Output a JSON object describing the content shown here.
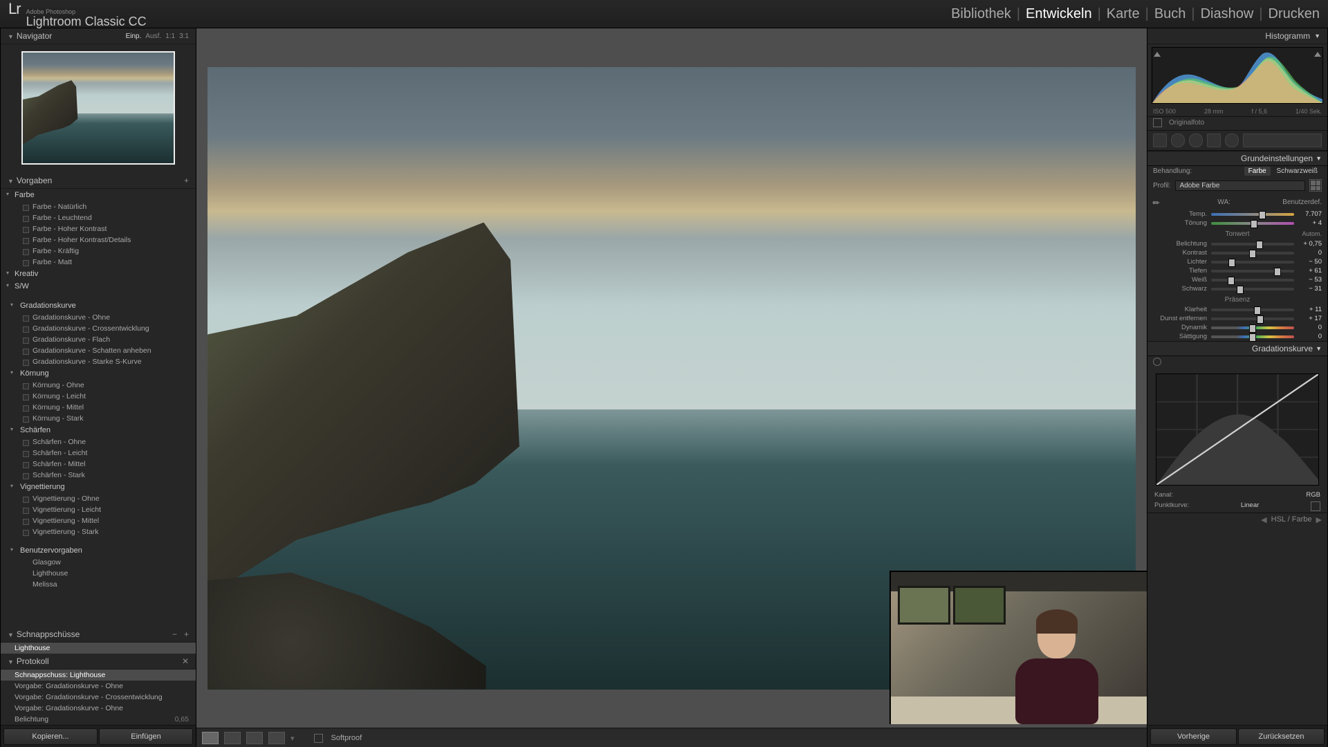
{
  "header": {
    "adobe": "Adobe Photoshop",
    "app_name": "Lightroom Classic CC",
    "modules": [
      "Bibliothek",
      "Entwickeln",
      "Karte",
      "Buch",
      "Diashow",
      "Drucken"
    ],
    "active_module": 1
  },
  "left": {
    "navigator": {
      "title": "Navigator",
      "zooms": [
        "Einp.",
        "Ausf.",
        "1:1",
        "3:1"
      ]
    },
    "presets": {
      "title": "Vorgaben",
      "groups": [
        {
          "name": "Farbe",
          "items": [
            "Farbe - Natürlich",
            "Farbe - Leuchtend",
            "Farbe - Hoher Kontrast",
            "Farbe - Hoher Kontrast/Details",
            "Farbe - Kräftig",
            "Farbe - Matt"
          ]
        },
        {
          "name": "Kreativ",
          "items": []
        },
        {
          "name": "S/W",
          "items": []
        },
        {
          "name": "Gradationskurve",
          "items": [
            "Gradationskurve - Ohne",
            "Gradationskurve - Crossentwicklung",
            "Gradationskurve - Flach",
            "Gradationskurve - Schatten anheben",
            "Gradationskurve - Starke S-Kurve"
          ]
        },
        {
          "name": "Körnung",
          "items": [
            "Körnung - Ohne",
            "Körnung - Leicht",
            "Körnung - Mittel",
            "Körnung - Stark"
          ]
        },
        {
          "name": "Schärfen",
          "items": [
            "Schärfen - Ohne",
            "Schärfen - Leicht",
            "Schärfen - Mittel",
            "Schärfen - Stark"
          ]
        },
        {
          "name": "Vignettierung",
          "items": [
            "Vignettierung - Ohne",
            "Vignettierung - Leicht",
            "Vignettierung - Mittel",
            "Vignettierung - Stark"
          ]
        },
        {
          "name": "Benutzervorgaben",
          "user": true,
          "items": [
            "Glasgow",
            "Lighthouse",
            "Melissa"
          ]
        }
      ]
    },
    "snapshots": {
      "title": "Schnappschüsse",
      "items": [
        "Lighthouse"
      ],
      "selected": 0
    },
    "history": {
      "title": "Protokoll",
      "items": [
        "Schnappschuss: Lighthouse",
        "Vorgabe: Gradationskurve - Ohne",
        "Vorgabe: Gradationskurve - Crossentwicklung",
        "Vorgabe: Gradationskurve - Ohne",
        "Belichtung"
      ],
      "selected": 0,
      "right_meta": [
        "",
        "",
        "",
        "",
        "0,65"
      ]
    },
    "buttons": {
      "copy": "Kopieren...",
      "paste": "Einfügen"
    }
  },
  "center": {
    "softproof": "Softproof"
  },
  "right": {
    "histogram": {
      "title": "Histogramm",
      "meta": [
        "ISO 500",
        "28 mm",
        "f / 5,6",
        "1/40 Sek."
      ],
      "original": "Originalfoto"
    },
    "basic": {
      "title": "Grundeinstellungen",
      "treatment_label": "Behandlung:",
      "treatment_options": [
        "Farbe",
        "Schwarzweiß"
      ],
      "treatment_active": 0,
      "profile_label": "Profil:",
      "profile_value": "Adobe Farbe",
      "wb_label": "WA:",
      "wb_value": "Benutzerdef.",
      "temp": {
        "label": "Temp.",
        "value": "7.707",
        "pos": 62
      },
      "tint": {
        "label": "Tönung",
        "value": "+ 4",
        "pos": 52
      },
      "tone_header": "Tonwert",
      "auto_label": "Autom.",
      "exposure": {
        "label": "Belichtung",
        "value": "+ 0,75",
        "pos": 58
      },
      "contrast": {
        "label": "Kontrast",
        "value": "0",
        "pos": 50
      },
      "highlights": {
        "label": "Lichter",
        "value": "− 50",
        "pos": 25
      },
      "shadows": {
        "label": "Tiefen",
        "value": "+ 61",
        "pos": 80
      },
      "whites": {
        "label": "Weiß",
        "value": "− 53",
        "pos": 24
      },
      "blacks": {
        "label": "Schwarz",
        "value": "− 31",
        "pos": 35
      },
      "presence_header": "Präsenz",
      "clarity": {
        "label": "Klarheit",
        "value": "+ 11",
        "pos": 56
      },
      "dehaze": {
        "label": "Dunst entfernen",
        "value": "+ 17",
        "pos": 59
      },
      "vibrance": {
        "label": "Dynamik",
        "value": "0",
        "pos": 50
      },
      "saturation": {
        "label": "Sättigung",
        "value": "0",
        "pos": 50
      }
    },
    "tonecurve": {
      "title": "Gradationskurve",
      "channel_label": "Kanal:",
      "channel_value": "RGB",
      "pointcurve_label": "Punktkurve:",
      "pointcurve_value": "Linear"
    },
    "hsl": {
      "title": "HSL / Farbe"
    },
    "buttons": {
      "prev": "Vorherige",
      "reset": "Zurücksetzen"
    }
  }
}
